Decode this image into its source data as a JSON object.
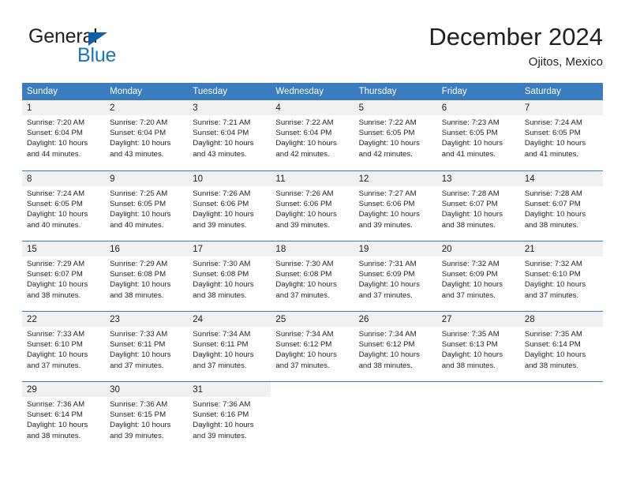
{
  "brand": {
    "name_part1": "General",
    "name_part2": "Blue",
    "triangle_color": "#1060a8",
    "blue_color": "#1b75bb"
  },
  "header": {
    "title": "December 2024",
    "subtitle": "Ojitos, Mexico"
  },
  "theme": {
    "header_bg": "#3a7cc0",
    "daynum_bg": "#f0f0f0",
    "text": "#231f20"
  },
  "weekdays": [
    "Sunday",
    "Monday",
    "Tuesday",
    "Wednesday",
    "Thursday",
    "Friday",
    "Saturday"
  ],
  "weeks": [
    [
      {
        "day": "1",
        "sunrise": "Sunrise: 7:20 AM",
        "sunset": "Sunset: 6:04 PM",
        "daylight1": "Daylight: 10 hours",
        "daylight2": "and 44 minutes."
      },
      {
        "day": "2",
        "sunrise": "Sunrise: 7:20 AM",
        "sunset": "Sunset: 6:04 PM",
        "daylight1": "Daylight: 10 hours",
        "daylight2": "and 43 minutes."
      },
      {
        "day": "3",
        "sunrise": "Sunrise: 7:21 AM",
        "sunset": "Sunset: 6:04 PM",
        "daylight1": "Daylight: 10 hours",
        "daylight2": "and 43 minutes."
      },
      {
        "day": "4",
        "sunrise": "Sunrise: 7:22 AM",
        "sunset": "Sunset: 6:04 PM",
        "daylight1": "Daylight: 10 hours",
        "daylight2": "and 42 minutes."
      },
      {
        "day": "5",
        "sunrise": "Sunrise: 7:22 AM",
        "sunset": "Sunset: 6:05 PM",
        "daylight1": "Daylight: 10 hours",
        "daylight2": "and 42 minutes."
      },
      {
        "day": "6",
        "sunrise": "Sunrise: 7:23 AM",
        "sunset": "Sunset: 6:05 PM",
        "daylight1": "Daylight: 10 hours",
        "daylight2": "and 41 minutes."
      },
      {
        "day": "7",
        "sunrise": "Sunrise: 7:24 AM",
        "sunset": "Sunset: 6:05 PM",
        "daylight1": "Daylight: 10 hours",
        "daylight2": "and 41 minutes."
      }
    ],
    [
      {
        "day": "8",
        "sunrise": "Sunrise: 7:24 AM",
        "sunset": "Sunset: 6:05 PM",
        "daylight1": "Daylight: 10 hours",
        "daylight2": "and 40 minutes."
      },
      {
        "day": "9",
        "sunrise": "Sunrise: 7:25 AM",
        "sunset": "Sunset: 6:05 PM",
        "daylight1": "Daylight: 10 hours",
        "daylight2": "and 40 minutes."
      },
      {
        "day": "10",
        "sunrise": "Sunrise: 7:26 AM",
        "sunset": "Sunset: 6:06 PM",
        "daylight1": "Daylight: 10 hours",
        "daylight2": "and 39 minutes."
      },
      {
        "day": "11",
        "sunrise": "Sunrise: 7:26 AM",
        "sunset": "Sunset: 6:06 PM",
        "daylight1": "Daylight: 10 hours",
        "daylight2": "and 39 minutes."
      },
      {
        "day": "12",
        "sunrise": "Sunrise: 7:27 AM",
        "sunset": "Sunset: 6:06 PM",
        "daylight1": "Daylight: 10 hours",
        "daylight2": "and 39 minutes."
      },
      {
        "day": "13",
        "sunrise": "Sunrise: 7:28 AM",
        "sunset": "Sunset: 6:07 PM",
        "daylight1": "Daylight: 10 hours",
        "daylight2": "and 38 minutes."
      },
      {
        "day": "14",
        "sunrise": "Sunrise: 7:28 AM",
        "sunset": "Sunset: 6:07 PM",
        "daylight1": "Daylight: 10 hours",
        "daylight2": "and 38 minutes."
      }
    ],
    [
      {
        "day": "15",
        "sunrise": "Sunrise: 7:29 AM",
        "sunset": "Sunset: 6:07 PM",
        "daylight1": "Daylight: 10 hours",
        "daylight2": "and 38 minutes."
      },
      {
        "day": "16",
        "sunrise": "Sunrise: 7:29 AM",
        "sunset": "Sunset: 6:08 PM",
        "daylight1": "Daylight: 10 hours",
        "daylight2": "and 38 minutes."
      },
      {
        "day": "17",
        "sunrise": "Sunrise: 7:30 AM",
        "sunset": "Sunset: 6:08 PM",
        "daylight1": "Daylight: 10 hours",
        "daylight2": "and 38 minutes."
      },
      {
        "day": "18",
        "sunrise": "Sunrise: 7:30 AM",
        "sunset": "Sunset: 6:08 PM",
        "daylight1": "Daylight: 10 hours",
        "daylight2": "and 37 minutes."
      },
      {
        "day": "19",
        "sunrise": "Sunrise: 7:31 AM",
        "sunset": "Sunset: 6:09 PM",
        "daylight1": "Daylight: 10 hours",
        "daylight2": "and 37 minutes."
      },
      {
        "day": "20",
        "sunrise": "Sunrise: 7:32 AM",
        "sunset": "Sunset: 6:09 PM",
        "daylight1": "Daylight: 10 hours",
        "daylight2": "and 37 minutes."
      },
      {
        "day": "21",
        "sunrise": "Sunrise: 7:32 AM",
        "sunset": "Sunset: 6:10 PM",
        "daylight1": "Daylight: 10 hours",
        "daylight2": "and 37 minutes."
      }
    ],
    [
      {
        "day": "22",
        "sunrise": "Sunrise: 7:33 AM",
        "sunset": "Sunset: 6:10 PM",
        "daylight1": "Daylight: 10 hours",
        "daylight2": "and 37 minutes."
      },
      {
        "day": "23",
        "sunrise": "Sunrise: 7:33 AM",
        "sunset": "Sunset: 6:11 PM",
        "daylight1": "Daylight: 10 hours",
        "daylight2": "and 37 minutes."
      },
      {
        "day": "24",
        "sunrise": "Sunrise: 7:34 AM",
        "sunset": "Sunset: 6:11 PM",
        "daylight1": "Daylight: 10 hours",
        "daylight2": "and 37 minutes."
      },
      {
        "day": "25",
        "sunrise": "Sunrise: 7:34 AM",
        "sunset": "Sunset: 6:12 PM",
        "daylight1": "Daylight: 10 hours",
        "daylight2": "and 37 minutes."
      },
      {
        "day": "26",
        "sunrise": "Sunrise: 7:34 AM",
        "sunset": "Sunset: 6:12 PM",
        "daylight1": "Daylight: 10 hours",
        "daylight2": "and 38 minutes."
      },
      {
        "day": "27",
        "sunrise": "Sunrise: 7:35 AM",
        "sunset": "Sunset: 6:13 PM",
        "daylight1": "Daylight: 10 hours",
        "daylight2": "and 38 minutes."
      },
      {
        "day": "28",
        "sunrise": "Sunrise: 7:35 AM",
        "sunset": "Sunset: 6:14 PM",
        "daylight1": "Daylight: 10 hours",
        "daylight2": "and 38 minutes."
      }
    ],
    [
      {
        "day": "29",
        "sunrise": "Sunrise: 7:36 AM",
        "sunset": "Sunset: 6:14 PM",
        "daylight1": "Daylight: 10 hours",
        "daylight2": "and 38 minutes."
      },
      {
        "day": "30",
        "sunrise": "Sunrise: 7:36 AM",
        "sunset": "Sunset: 6:15 PM",
        "daylight1": "Daylight: 10 hours",
        "daylight2": "and 39 minutes."
      },
      {
        "day": "31",
        "sunrise": "Sunrise: 7:36 AM",
        "sunset": "Sunset: 6:16 PM",
        "daylight1": "Daylight: 10 hours",
        "daylight2": "and 39 minutes."
      },
      {
        "day": "",
        "sunrise": "",
        "sunset": "",
        "daylight1": "",
        "daylight2": ""
      },
      {
        "day": "",
        "sunrise": "",
        "sunset": "",
        "daylight1": "",
        "daylight2": ""
      },
      {
        "day": "",
        "sunrise": "",
        "sunset": "",
        "daylight1": "",
        "daylight2": ""
      },
      {
        "day": "",
        "sunrise": "",
        "sunset": "",
        "daylight1": "",
        "daylight2": ""
      }
    ]
  ]
}
